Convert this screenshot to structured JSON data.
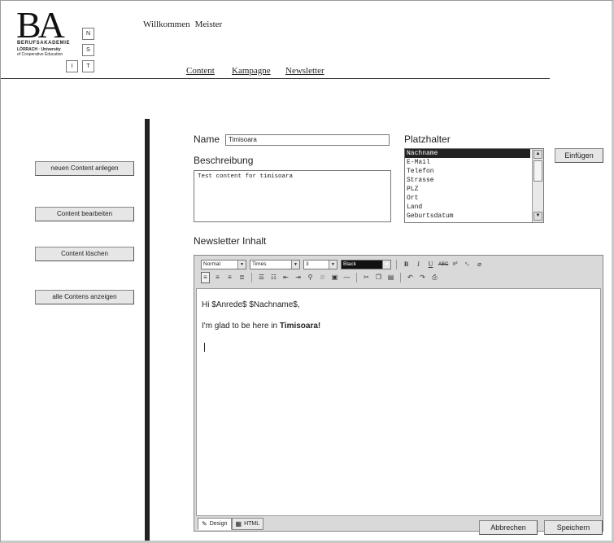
{
  "header": {
    "logo_letters": "BA",
    "logo_name": "BERUFSAKADEMIE",
    "logo_sub1": "LÖRRACH · University",
    "logo_sub2": "of Cooperative Education",
    "logo_boxes": [
      "N",
      "S",
      "I",
      "T"
    ],
    "welcome_label": "Willkommen",
    "user_name": "Meister"
  },
  "nav": {
    "content": "Content",
    "kampagne": "Kampagne",
    "newsletter": "Newsletter"
  },
  "sidebar": {
    "new_content": "neuen Content anlegen",
    "edit_content": "Content bearbeiten",
    "delete_content": "Content löschen",
    "show_all": "alle Contens anzeigen"
  },
  "form": {
    "name_label": "Name",
    "name_value": "Timisoara",
    "description_label": "Beschreibung",
    "description_value": "Test content for timisoara",
    "placeholder_label": "Platzhalter",
    "placeholder_options": [
      "Nachname",
      "E-Mail",
      "Telefon",
      "Strasse",
      "PLZ",
      "Ort",
      "Land",
      "Geburtsdatum"
    ],
    "placeholder_selected": "Nachname",
    "insert_button": "Einfügen",
    "newsletter_label": "Newsletter Inhalt"
  },
  "editor": {
    "format_select": "Normal",
    "font_select": "Times",
    "size_select": "3",
    "color_select": "Black",
    "toolbar_row1_icons": [
      "bold-icon",
      "italic-icon",
      "underline-icon",
      "strikethrough-icon",
      "superscript-icon",
      "subscript-icon",
      "eraser-icon"
    ],
    "toolbar_row2_icons": [
      "align-left-icon",
      "align-center-icon",
      "align-right-icon",
      "justify-icon",
      "unordered-list-icon",
      "ordered-list-icon",
      "outdent-icon",
      "indent-icon",
      "link-icon",
      "unlink-icon",
      "image-icon",
      "horizontal-rule-icon",
      "cut-icon",
      "copy-icon",
      "paste-icon",
      "undo-icon",
      "redo-icon",
      "print-icon"
    ],
    "line1": "Hi $Anrede$ $Nachname$,",
    "line2_prefix": "I'm glad to be here in ",
    "line2_bold": "Timisoara!",
    "tab_design": "Design",
    "tab_html": "HTML"
  },
  "actions": {
    "cancel": "Abbrechen",
    "save": "Speichern"
  }
}
